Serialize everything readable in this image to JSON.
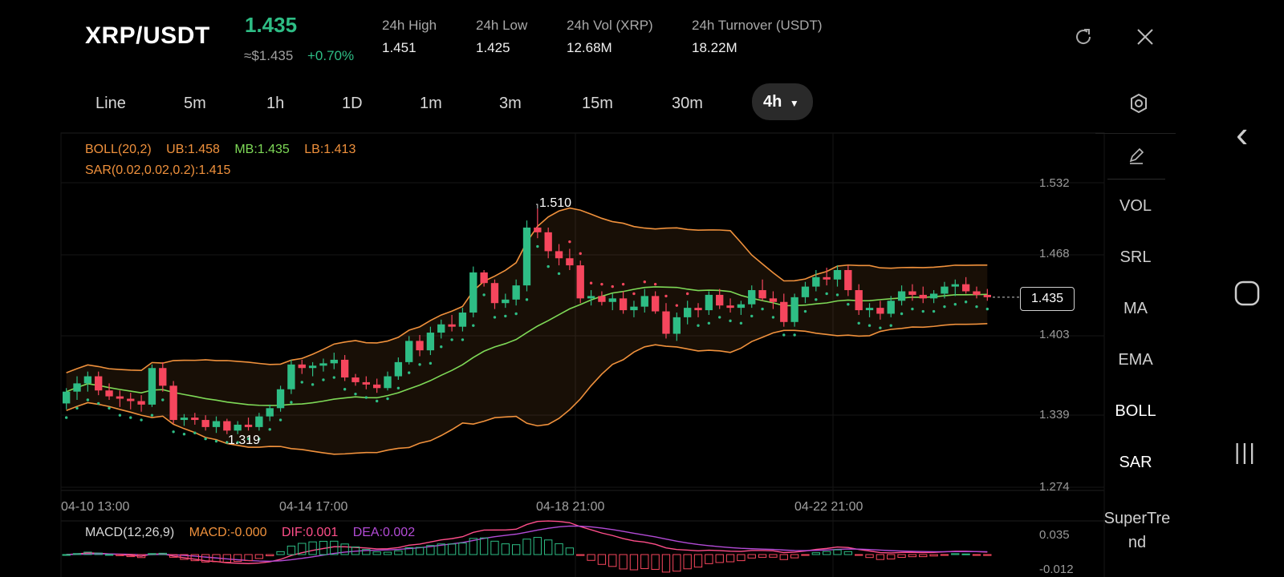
{
  "header": {
    "pair": "XRP/USDT",
    "price": "1.435",
    "approx": "≈$1.435",
    "change": "+0.70%",
    "stats": [
      {
        "label": "24h   High",
        "value": "1.451"
      },
      {
        "label": "24h   Low",
        "value": "1.425"
      },
      {
        "label": "24h   Vol (XRP)",
        "value": "12.68M"
      },
      {
        "label": "24h   Turnover (USDT)",
        "value": "18.22M"
      }
    ]
  },
  "timeframes": [
    "Line",
    "5m",
    "1h",
    "1D",
    "1m",
    "3m",
    "15m",
    "30m"
  ],
  "active_timeframe": "4h",
  "indicators": {
    "boll": {
      "name": "BOLL(20,2)",
      "ub": "UB:1.458",
      "mb": "MB:1.435",
      "lb": "LB:1.413"
    },
    "sar": "SAR(0.02,0.02,0.2):1.415",
    "macd": {
      "name": "MACD(12,26,9)",
      "macd": "MACD:-0.000",
      "dif": "DIF:0.001",
      "dea": "DEA:0.002"
    }
  },
  "side_menu": [
    "VOL",
    "SRL",
    "MA",
    "EMA",
    "BOLL",
    "SAR",
    "SuperTre nd"
  ],
  "colors": {
    "up": "#2ebd85",
    "down": "#f6465d",
    "boll_band": "#f0913c",
    "mb": "#7ed957",
    "sar": "#2ebd85",
    "dif": "#ff4e8a",
    "dea": "#b34bd6"
  },
  "chart_data": {
    "type": "candlestick",
    "y_ticks": [
      "1.532",
      "1.468",
      "1.403",
      "1.339",
      "1.274"
    ],
    "x_ticks": [
      "04-10 13:00",
      "04-14 17:00",
      "04-18 21:00",
      "04-22 21:00"
    ],
    "ylim": [
      1.274,
      1.532
    ],
    "current_price": "1.435",
    "high_marker": "1.510",
    "low_marker": "1.319",
    "macd_ticks": [
      "0.035",
      "-0.012"
    ],
    "candles": [
      [
        1.345,
        1.358,
        1.34,
        1.355
      ],
      [
        1.355,
        1.368,
        1.348,
        1.362
      ],
      [
        1.362,
        1.372,
        1.355,
        1.368
      ],
      [
        1.368,
        1.372,
        1.352,
        1.356
      ],
      [
        1.356,
        1.362,
        1.348,
        1.351
      ],
      [
        1.351,
        1.356,
        1.342,
        1.349
      ],
      [
        1.349,
        1.354,
        1.34,
        1.347
      ],
      [
        1.347,
        1.352,
        1.338,
        1.344
      ],
      [
        1.344,
        1.378,
        1.342,
        1.375
      ],
      [
        1.375,
        1.38,
        1.355,
        1.36
      ],
      [
        1.36,
        1.364,
        1.328,
        1.331
      ],
      [
        1.331,
        1.336,
        1.326,
        1.333
      ],
      [
        1.333,
        1.337,
        1.327,
        1.331
      ],
      [
        1.331,
        1.335,
        1.322,
        1.325
      ],
      [
        1.325,
        1.334,
        1.32,
        1.33
      ],
      [
        1.33,
        1.332,
        1.319,
        1.322
      ],
      [
        1.322,
        1.33,
        1.319,
        1.327
      ],
      [
        1.327,
        1.333,
        1.322,
        1.325
      ],
      [
        1.325,
        1.337,
        1.322,
        1.334
      ],
      [
        1.334,
        1.344,
        1.33,
        1.341
      ],
      [
        1.341,
        1.36,
        1.338,
        1.357
      ],
      [
        1.357,
        1.382,
        1.353,
        1.378
      ],
      [
        1.378,
        1.382,
        1.37,
        1.375
      ],
      [
        1.375,
        1.38,
        1.368,
        1.377
      ],
      [
        1.377,
        1.383,
        1.372,
        1.379
      ],
      [
        1.379,
        1.388,
        1.374,
        1.382
      ],
      [
        1.382,
        1.386,
        1.364,
        1.367
      ],
      [
        1.367,
        1.37,
        1.36,
        1.363
      ],
      [
        1.363,
        1.368,
        1.357,
        1.361
      ],
      [
        1.361,
        1.366,
        1.354,
        1.358
      ],
      [
        1.358,
        1.372,
        1.356,
        1.368
      ],
      [
        1.368,
        1.384,
        1.365,
        1.38
      ],
      [
        1.38,
        1.402,
        1.378,
        1.398
      ],
      [
        1.398,
        1.403,
        1.385,
        1.39
      ],
      [
        1.39,
        1.41,
        1.386,
        1.405
      ],
      [
        1.405,
        1.416,
        1.4,
        1.412
      ],
      [
        1.412,
        1.42,
        1.406,
        1.41
      ],
      [
        1.41,
        1.426,
        1.406,
        1.422
      ],
      [
        1.422,
        1.461,
        1.418,
        1.456
      ],
      [
        1.456,
        1.458,
        1.444,
        1.447
      ],
      [
        1.447,
        1.45,
        1.425,
        1.43
      ],
      [
        1.43,
        1.438,
        1.426,
        1.433
      ],
      [
        1.433,
        1.45,
        1.428,
        1.445
      ],
      [
        1.445,
        1.5,
        1.44,
        1.494
      ],
      [
        1.494,
        1.51,
        1.485,
        1.49
      ],
      [
        1.49,
        1.494,
        1.468,
        1.474
      ],
      [
        1.474,
        1.48,
        1.462,
        1.468
      ],
      [
        1.468,
        1.476,
        1.458,
        1.462
      ],
      [
        1.462,
        1.466,
        1.43,
        1.434
      ],
      [
        1.434,
        1.441,
        1.428,
        1.436
      ],
      [
        1.436,
        1.44,
        1.428,
        1.431
      ],
      [
        1.431,
        1.438,
        1.424,
        1.434
      ],
      [
        1.434,
        1.44,
        1.421,
        1.424
      ],
      [
        1.424,
        1.432,
        1.418,
        1.427
      ],
      [
        1.427,
        1.442,
        1.422,
        1.436
      ],
      [
        1.436,
        1.44,
        1.421,
        1.423
      ],
      [
        1.423,
        1.43,
        1.4,
        1.404
      ],
      [
        1.404,
        1.422,
        1.398,
        1.418
      ],
      [
        1.418,
        1.432,
        1.412,
        1.426
      ],
      [
        1.426,
        1.43,
        1.418,
        1.424
      ],
      [
        1.424,
        1.44,
        1.42,
        1.437
      ],
      [
        1.437,
        1.442,
        1.425,
        1.428
      ],
      [
        1.428,
        1.434,
        1.422,
        1.426
      ],
      [
        1.426,
        1.432,
        1.42,
        1.429
      ],
      [
        1.429,
        1.445,
        1.426,
        1.441
      ],
      [
        1.441,
        1.45,
        1.432,
        1.434
      ],
      [
        1.434,
        1.44,
        1.425,
        1.431
      ],
      [
        1.431,
        1.438,
        1.41,
        1.414
      ],
      [
        1.414,
        1.438,
        1.41,
        1.435
      ],
      [
        1.435,
        1.448,
        1.43,
        1.444
      ],
      [
        1.444,
        1.458,
        1.44,
        1.452
      ],
      [
        1.452,
        1.46,
        1.445,
        1.45
      ],
      [
        1.45,
        1.462,
        1.444,
        1.458
      ],
      [
        1.458,
        1.462,
        1.436,
        1.441
      ],
      [
        1.441,
        1.446,
        1.42,
        1.424
      ],
      [
        1.424,
        1.43,
        1.418,
        1.426
      ],
      [
        1.426,
        1.432,
        1.416,
        1.421
      ],
      [
        1.421,
        1.436,
        1.418,
        1.432
      ],
      [
        1.432,
        1.445,
        1.428,
        1.44
      ],
      [
        1.44,
        1.446,
        1.432,
        1.437
      ],
      [
        1.437,
        1.444,
        1.43,
        1.434
      ],
      [
        1.434,
        1.441,
        1.43,
        1.438
      ],
      [
        1.438,
        1.448,
        1.434,
        1.444
      ],
      [
        1.444,
        1.45,
        1.436,
        1.446
      ],
      [
        1.446,
        1.452,
        1.438,
        1.44
      ],
      [
        1.44,
        1.444,
        1.434,
        1.437
      ],
      [
        1.437,
        1.442,
        1.432,
        1.435
      ]
    ]
  },
  "nav": {
    "back": "‹",
    "home": "○",
    "recents": "|||"
  }
}
